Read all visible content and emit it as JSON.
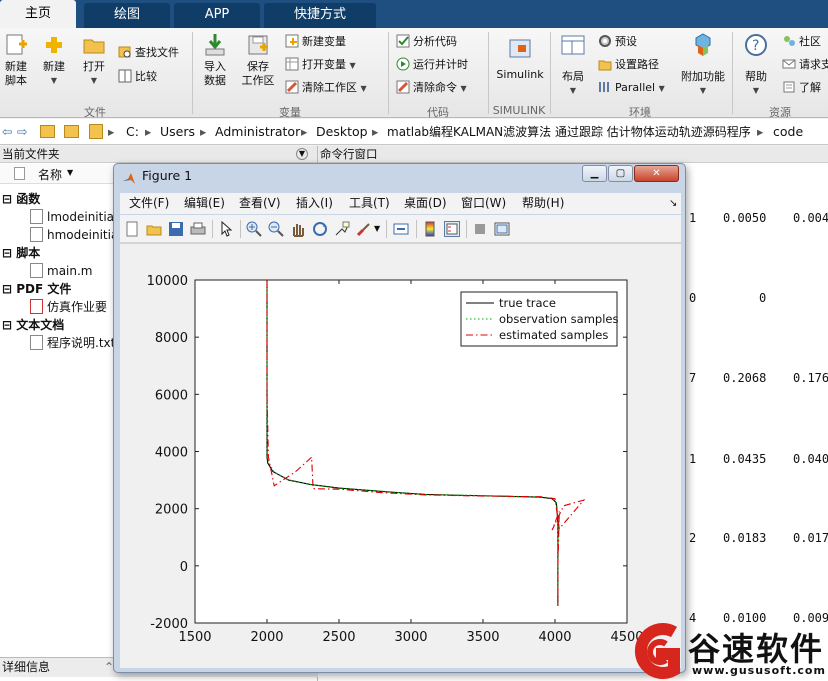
{
  "tabs": [
    {
      "label": "主页",
      "active": true
    },
    {
      "label": "绘图",
      "active": false
    },
    {
      "label": "APP",
      "active": false
    },
    {
      "label": "快捷方式",
      "active": false
    }
  ],
  "ribbon": {
    "file": {
      "new_script": "新建\n脚本",
      "new": "新建",
      "open": "打开",
      "find_files": "查找文件",
      "compare": "比较",
      "group": "文件"
    },
    "variable": {
      "import_data": "导入\n数据",
      "save_workspace": "保存\n工作区",
      "new_variable": "新建变量",
      "open_variable": "打开变量",
      "clear_workspace": "清除工作区",
      "group": "变量"
    },
    "code": {
      "analyze": "分析代码",
      "run_and_time": "运行并计时",
      "clear_commands": "清除命令",
      "group": "代码"
    },
    "simulink": {
      "label": "Simulink",
      "group": "SIMULINK"
    },
    "environment": {
      "layout": "布局",
      "preferences": "预设",
      "set_path": "设置路径",
      "parallel": "Parallel",
      "addons": "附加功能",
      "group": "环境"
    },
    "resources": {
      "help": "帮助",
      "community": "社区",
      "request_support": "请求支",
      "learn": "了解",
      "group": "资源"
    }
  },
  "address": {
    "path": [
      "C:",
      "Users",
      "Administrator",
      "Desktop",
      "matlab编程KALMAN滤波算法 通过跟踪 估计物体运动轨迹源码程序",
      "code"
    ]
  },
  "file_browser": {
    "title": "当前文件夹",
    "column_name": "名称",
    "groups": [
      {
        "label": "函数",
        "items": [
          "lmodeinitia",
          "hmodeinitia"
        ]
      },
      {
        "label": "脚本",
        "items": [
          "main.m"
        ]
      },
      {
        "label": "PDF 文件",
        "items": [
          "仿真作业要"
        ]
      },
      {
        "label": "文本文档",
        "items": [
          "程序说明.txt"
        ]
      }
    ],
    "details": "详细信息"
  },
  "command_window": {
    "title": "命令行窗口",
    "rows": [
      {
        "idx": "1",
        "a": "0.0050",
        "b": "0.004"
      },
      {
        "idx": "0",
        "a": "0",
        "b": ""
      },
      {
        "idx": "7",
        "a": "0.2068",
        "b": "0.176"
      },
      {
        "idx": "1",
        "a": "0.0435",
        "b": "0.040"
      },
      {
        "idx": "2",
        "a": "0.0183",
        "b": "0.017"
      },
      {
        "idx": "4",
        "a": "0.0100",
        "b": "0.009"
      }
    ]
  },
  "figure": {
    "title": "Figure 1",
    "menu": [
      "文件(F)",
      "编辑(E)",
      "查看(V)",
      "插入(I)",
      "工具(T)",
      "桌面(D)",
      "窗口(W)",
      "帮助(H)"
    ],
    "min_glyph": "▁",
    "max_glyph": "▢",
    "close_glyph": "✕"
  },
  "chart_data": {
    "type": "line",
    "xlim": [
      1500,
      4500
    ],
    "ylim": [
      -2000,
      10000
    ],
    "xticks": [
      1500,
      2000,
      2500,
      3000,
      3500,
      4000,
      4500
    ],
    "yticks": [
      -2000,
      0,
      2000,
      4000,
      6000,
      8000,
      10000
    ],
    "grid": false,
    "legend_position": "top-right",
    "series": [
      {
        "name": "true trace",
        "color": "#000000",
        "dash": "solid",
        "x": [
          2000,
          2000,
          2000,
          2005,
          2040,
          2150,
          2300,
          2500,
          2800,
          3100,
          3400,
          3700,
          3900,
          3980,
          4010,
          4020,
          4020,
          4020
        ],
        "y": [
          10000,
          6000,
          3800,
          3600,
          3300,
          3000,
          2850,
          2720,
          2600,
          2500,
          2460,
          2430,
          2400,
          2350,
          2200,
          1500,
          0,
          -1400
        ]
      },
      {
        "name": "observation samples",
        "color": "#00aa00",
        "dash": "dotted",
        "x": [
          2000,
          2000,
          2002,
          2010,
          2050,
          2150,
          2310,
          2500,
          2800,
          3100,
          3400,
          3700,
          3900,
          3985,
          4012,
          4022,
          4020,
          4020
        ],
        "y": [
          10000,
          6000,
          3850,
          3620,
          3280,
          3010,
          2840,
          2710,
          2610,
          2490,
          2470,
          2420,
          2410,
          2340,
          2180,
          1450,
          0,
          -1400
        ]
      },
      {
        "name": "estimated samples",
        "color": "#dd0000",
        "dash": "dashdot",
        "x": [
          2000,
          2000,
          2010,
          2050,
          2200,
          2310,
          2320,
          2500,
          2800,
          3100,
          3400,
          3700,
          3900,
          4000,
          4030,
          4200,
          4060,
          3980,
          4030,
          4020,
          4020
        ],
        "y": [
          10000,
          6000,
          3800,
          2800,
          3300,
          3800,
          2700,
          2680,
          2560,
          2480,
          2450,
          2430,
          2420,
          2350,
          1300,
          2300,
          2100,
          1250,
          1900,
          0,
          -1400
        ]
      }
    ]
  },
  "colors": {
    "tabbar": "#1e4f80",
    "matlab_accent": "#e16214",
    "watermark_red": "#d7261e"
  },
  "watermark": {
    "brand": "谷速软件",
    "url": "www.gususoft.com"
  }
}
